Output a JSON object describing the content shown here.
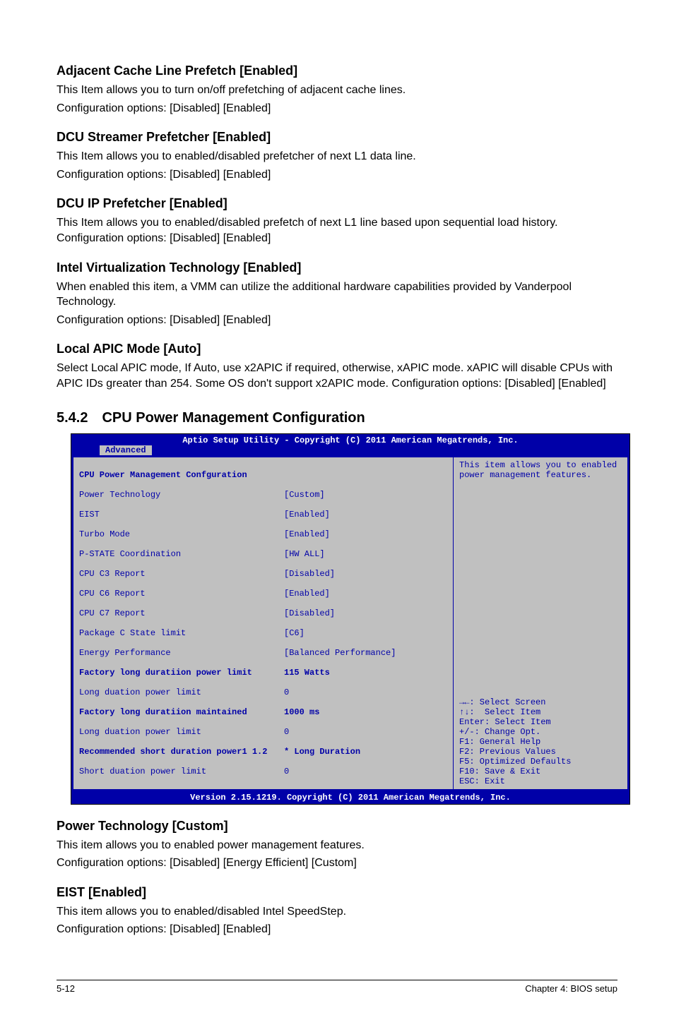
{
  "sections": {
    "s1": {
      "heading": "Adjacent Cache Line Prefetch [Enabled]",
      "p1": "This Item allows you to turn on/off prefetching of adjacent cache lines.",
      "p2": "Configuration options: [Disabled] [Enabled]"
    },
    "s2": {
      "heading": "DCU Streamer Prefetcher [Enabled]",
      "p1": "This Item allows you to enabled/disabled prefetcher of next L1 data line.",
      "p2": "Configuration options: [Disabled] [Enabled]"
    },
    "s3": {
      "heading": "DCU IP Prefetcher [Enabled]",
      "p1": "This Item allows you to enabled/disabled prefetch of next L1 line based upon sequential load history. Configuration options: [Disabled] [Enabled]"
    },
    "s4": {
      "heading": "Intel Virtualization Technology [Enabled]",
      "p1": "When enabled this item, a VMM can utilize the additional hardware capabilities provided by Vanderpool Technology.",
      "p2": "Configuration options: [Disabled] [Enabled]"
    },
    "s5": {
      "heading": "Local APIC Mode [Auto]",
      "p1": "Select Local APIC mode, If Auto, use x2APIC if required, otherwise, xAPIC mode. xAPIC will disable CPUs with APIC IDs greater than 254. Some OS don't support x2APIC mode. Configuration options: [Disabled] [Enabled]"
    }
  },
  "main_heading": "5.4.2 CPU Power Management Configuration",
  "bios": {
    "header": "Aptio Setup Utility - Copyright (C) 2011 American Megatrends, Inc.",
    "tab": "Advanced",
    "left_title": "CPU Power Management Confguration",
    "rows": [
      {
        "label": "Power Technology",
        "value": "[Custom]"
      },
      {
        "label": "EIST",
        "value": "[Enabled]"
      },
      {
        "label": "Turbo Mode",
        "value": "[Enabled]"
      },
      {
        "label": "P-STATE Coordination",
        "value": "[HW ALL]"
      },
      {
        "label": "CPU C3 Report",
        "value": "[Disabled]"
      },
      {
        "label": "CPU C6 Report",
        "value": "[Enabled]"
      },
      {
        "label": "CPU C7 Report",
        "value": "[Disabled]"
      },
      {
        "label": "Package C State limit",
        "value": "[C6]"
      },
      {
        "label": "Energy Performance",
        "value": "[Balanced Performance]"
      },
      {
        "label": "Factory long duratiion power limit",
        "value": "115 Watts"
      },
      {
        "label": "Long duation power limit",
        "value": "0"
      },
      {
        "label": "Factory long duratiion maintained",
        "value": "1000 ms"
      },
      {
        "label": "Long duation power limit",
        "value": "0"
      },
      {
        "label": "Recommended short duration power1 1.2",
        "value": "* Long Duration"
      },
      {
        "label": "Short duation power limit",
        "value": "0"
      }
    ],
    "right_top": "This item allows you to enabled power management features.",
    "right_bot": "→←: Select Screen\n↑↓:  Select Item\nEnter: Select Item\n+/-: Change Opt.\nF1: General Help\nF2: Previous Values\nF5: Optimized Defaults\nF10: Save & Exit\nESC: Exit",
    "footer": "Version 2.15.1219. Copyright (C) 2011 American Megatrends, Inc."
  },
  "post_sections": {
    "p1": {
      "heading": "Power Technology [Custom]",
      "t1": "This item allows you to enabled power management features.",
      "t2": "Configuration options: [Disabled] [Energy Efficient] [Custom]"
    },
    "p2": {
      "heading": "EIST [Enabled]",
      "t1": "This item allows you to enabled/disabled Intel SpeedStep.",
      "t2": "Configuration options: [Disabled] [Enabled]"
    }
  },
  "footer": {
    "left": "5-12",
    "right": "Chapter 4: BIOS setup"
  }
}
